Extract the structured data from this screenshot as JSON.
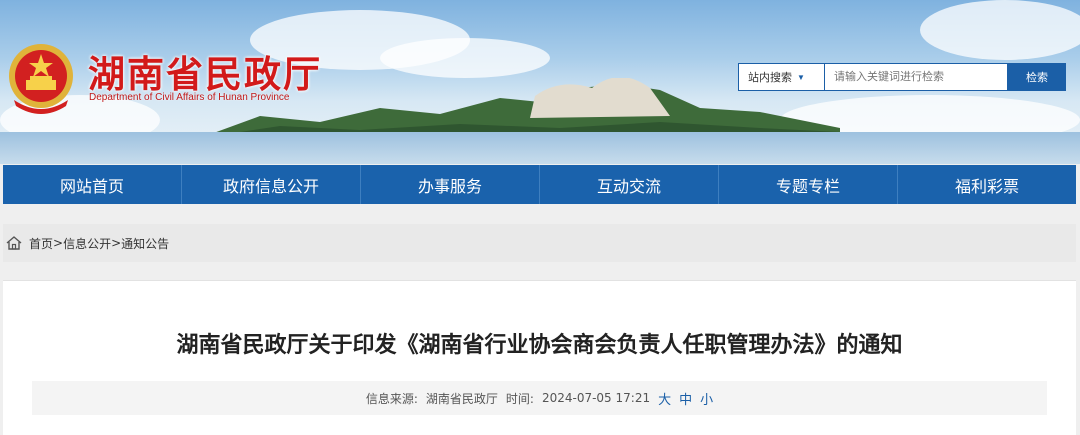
{
  "header": {
    "site_title": "湖南省民政厅",
    "site_subtitle": "Department of Civil Affairs of Hunan Province"
  },
  "search": {
    "scope_label": "站内搜索",
    "placeholder": "请输入关键词进行检索",
    "button_label": "检索"
  },
  "nav": {
    "items": [
      {
        "label": "网站首页"
      },
      {
        "label": "政府信息公开"
      },
      {
        "label": "办事服务"
      },
      {
        "label": "互动交流"
      },
      {
        "label": "专题专栏"
      },
      {
        "label": "福利彩票"
      }
    ]
  },
  "breadcrumb": {
    "items": [
      "首页",
      "信息公开",
      "通知公告"
    ],
    "separator": ">"
  },
  "article": {
    "title": "湖南省民政厅关于印发《湖南省行业协会商会负责人任职管理办法》的通知",
    "source_label": "信息来源:",
    "source": "湖南省民政厅",
    "time_label": "时间:",
    "time": "2024-07-05 17:21",
    "font_sizes": [
      "大",
      "中",
      "小"
    ]
  },
  "colors": {
    "brand_red": "#d21a1a",
    "nav_blue": "#1a62ac",
    "link_blue": "#1b5fa7"
  }
}
